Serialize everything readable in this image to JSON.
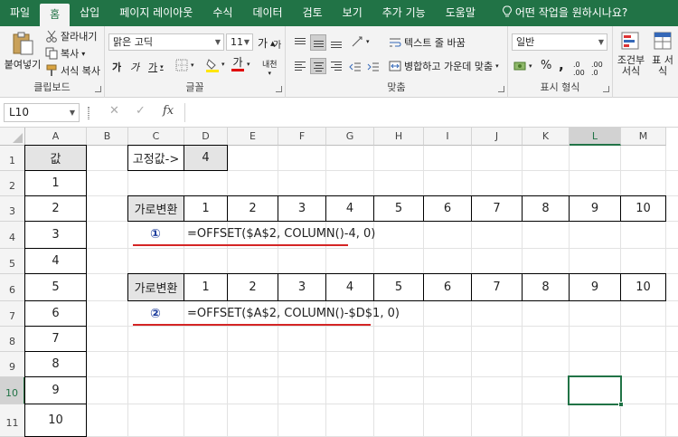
{
  "tabs": [
    "파일",
    "홈",
    "삽입",
    "페이지 레이아웃",
    "수식",
    "데이터",
    "검토",
    "보기",
    "추가 기능",
    "도움말",
    "어떤 작업을 원하시나요?"
  ],
  "ribbon": {
    "clipboard": {
      "paste": "붙여넣기",
      "cut": "잘라내기",
      "copy": "복사",
      "format_painter": "서식 복사",
      "label": "클립보드"
    },
    "font": {
      "name": "맑은 고딕",
      "size": "11",
      "bold": "가",
      "italic": "가",
      "underline": "가",
      "grow": "가",
      "shrink": "가",
      "font_color": "가",
      "phonetic": "내천",
      "label": "글꼴"
    },
    "alignment": {
      "wrap": "텍스트 줄 바꿈",
      "merge": "병합하고 가운데 맞춤",
      "label": "맞춤"
    },
    "number": {
      "format": "일반",
      "percent": "%",
      "comma": ",",
      "label": "표시 형식"
    },
    "styles": {
      "conditional": "조건부 서식",
      "table": "표 서식"
    }
  },
  "formula_bar": {
    "name_box": "L10",
    "cancel": "✕",
    "enter": "✓",
    "fx": "fx",
    "content": ""
  },
  "sheet": {
    "columns": [
      "A",
      "B",
      "C",
      "D",
      "E",
      "F",
      "G",
      "H",
      "I",
      "J",
      "K",
      "L",
      "M"
    ],
    "rows": [
      "1",
      "2",
      "3",
      "4",
      "5",
      "6",
      "7",
      "8",
      "9",
      "10",
      "11"
    ],
    "a_header": "값",
    "a_values": [
      "1",
      "2",
      "3",
      "4",
      "5",
      "6",
      "7",
      "8",
      "9",
      "10"
    ],
    "fixed_label": "고정값->",
    "fixed_value": "4",
    "transform_label": "가로변환",
    "row3_values": [
      "1",
      "2",
      "3",
      "4",
      "5",
      "6",
      "7",
      "8",
      "9",
      "10"
    ],
    "row6_values": [
      "1",
      "2",
      "3",
      "4",
      "5",
      "6",
      "7",
      "8",
      "9",
      "10"
    ],
    "marker1": "①",
    "formula1": "=OFFSET($A$2, COLUMN()-4, 0)",
    "marker2": "②",
    "formula2": "=OFFSET($A$2, COLUMN()-$D$1, 0)",
    "selected_cell": "L10",
    "accent": "#217346",
    "annotation_color": "#d42525"
  }
}
